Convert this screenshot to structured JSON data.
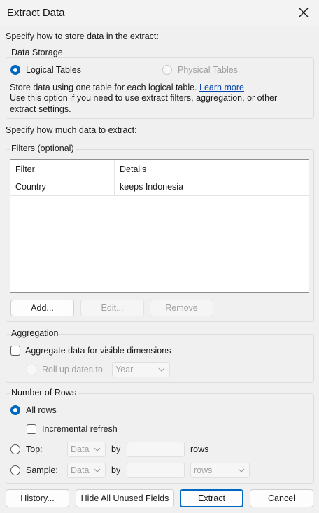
{
  "window": {
    "title": "Extract Data"
  },
  "intro_text": "Specify how to store data in the extract:",
  "data_storage": {
    "legend": "Data Storage",
    "logical_label": "Logical Tables",
    "physical_label": "Physical Tables",
    "desc_line1": "Store data using one table for each logical table.",
    "learn_more": "Learn more",
    "desc_line2": "Use this option if you need to use extract filters, aggregation, or other",
    "desc_line3": "extract settings."
  },
  "amount_text": "Specify how much data to extract:",
  "filters": {
    "legend": "Filters (optional)",
    "columns": [
      "Filter",
      "Details"
    ],
    "rows": [
      {
        "filter": "Country",
        "details": "keeps Indonesia"
      }
    ],
    "add_label": "Add...",
    "edit_label": "Edit...",
    "remove_label": "Remove"
  },
  "aggregation": {
    "legend": "Aggregation",
    "aggregate_label": "Aggregate data for visible dimensions",
    "rollup_label": "Roll up dates to",
    "rollup_value": "Year"
  },
  "rows": {
    "legend": "Number of Rows",
    "all_rows_label": "All rows",
    "incremental_label": "Incremental refresh",
    "top_label": "Top:",
    "top_combo": "Data",
    "by_label": "by",
    "rows_suffix": "rows",
    "sample_label": "Sample:",
    "sample_combo": "Data",
    "sample_by": "by",
    "sample_rows_combo": "rows"
  },
  "footer": {
    "history_label": "History...",
    "hide_fields_label": "Hide All Unused Fields",
    "extract_label": "Extract",
    "cancel_label": "Cancel"
  },
  "colors": {
    "accent": "#0067c0",
    "link": "#0645ad",
    "background": "#f0f0f0"
  },
  "icons": {
    "close": "close-icon",
    "chevron": "chevron-down-icon"
  }
}
